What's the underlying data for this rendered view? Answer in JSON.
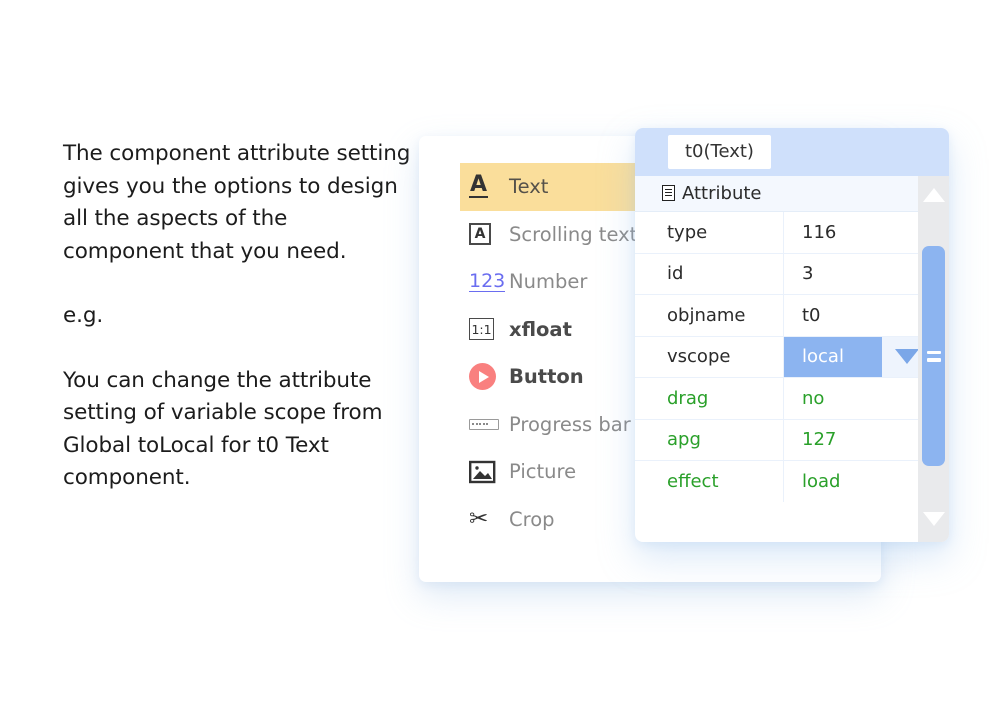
{
  "description": {
    "paragraphs": [
      "The component attribute setting gives you the options to design all the aspects of the component that you need.",
      "e.g.",
      "You can change the attribute setting of variable scope from Global toLocal for t0 Text component."
    ]
  },
  "component_panel": {
    "items": [
      {
        "label": "Text",
        "icon": "letter-a-underlined-icon",
        "selected": true,
        "emphasis": "selected"
      },
      {
        "label": "Scrolling text",
        "icon": "letter-a-boxed-icon",
        "selected": false,
        "emphasis": "normal"
      },
      {
        "label": "Number",
        "icon": "digits-123-icon",
        "selected": false,
        "emphasis": "normal"
      },
      {
        "label": "xfloat",
        "icon": "ratio-1-to-1-icon",
        "selected": false,
        "emphasis": "dark"
      },
      {
        "label": "Button",
        "icon": "play-circle-icon",
        "selected": false,
        "emphasis": "dark"
      },
      {
        "label": "Progress bar",
        "icon": "progress-bar-icon",
        "selected": false,
        "emphasis": "normal"
      },
      {
        "label": "Picture",
        "icon": "picture-icon",
        "selected": false,
        "emphasis": "normal"
      },
      {
        "label": "Crop",
        "icon": "scissors-icon",
        "selected": false,
        "emphasis": "normal"
      }
    ]
  },
  "attribute_panel": {
    "object_tab_label": "t0(Text)",
    "section_title": "Attribute",
    "section_icon": "document-icon",
    "rows": [
      {
        "key": "type",
        "value": "116",
        "green": false,
        "dropdown": false
      },
      {
        "key": "id",
        "value": "3",
        "green": false,
        "dropdown": false
      },
      {
        "key": "objname",
        "value": "t0",
        "green": false,
        "dropdown": false
      },
      {
        "key": "vscope",
        "value": "local",
        "green": false,
        "dropdown": true
      },
      {
        "key": "drag",
        "value": "no",
        "green": true,
        "dropdown": false
      },
      {
        "key": "apg",
        "value": "127",
        "green": true,
        "dropdown": false
      },
      {
        "key": "effect",
        "value": "load",
        "green": true,
        "dropdown": false
      }
    ]
  },
  "colors": {
    "selected_row": "#fade9b",
    "header_blue": "#cfe0fb",
    "accent_blue": "#8cb4f0",
    "green_text": "#2aa02a",
    "button_red": "#f9807f",
    "number_blue": "#6a6df0"
  }
}
